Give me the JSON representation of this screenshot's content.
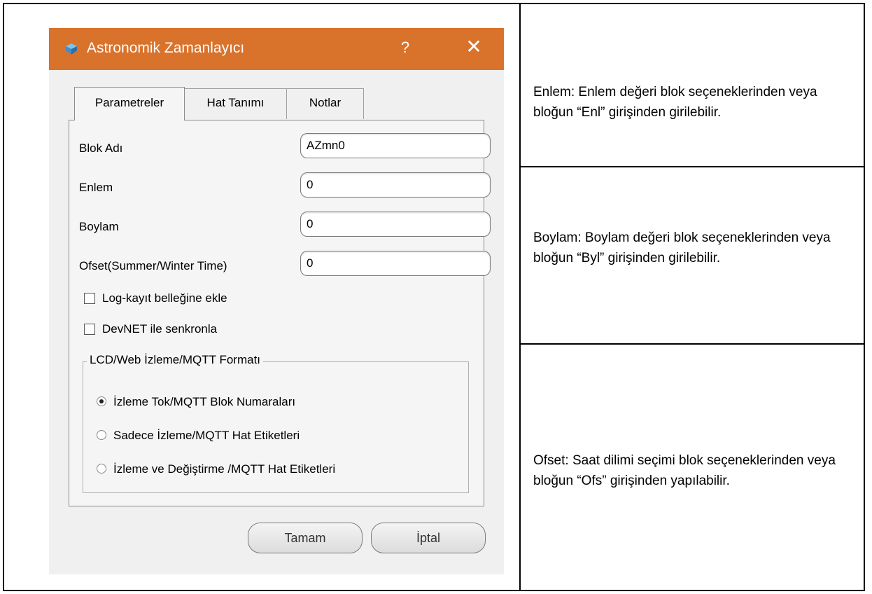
{
  "dialog": {
    "title": "Astronomik Zamanlayıcı",
    "help_label": "?",
    "close_label": "✕",
    "tabs": [
      {
        "label": "Parametreler",
        "active": true
      },
      {
        "label": "Hat Tanımı",
        "active": false
      },
      {
        "label": "Notlar",
        "active": false
      }
    ],
    "fields": [
      {
        "label": "Blok Adı",
        "value": "AZmn0"
      },
      {
        "label": "Enlem",
        "value": "0"
      },
      {
        "label": "Boylam",
        "value": "0"
      },
      {
        "label": "Ofset(Summer/Winter Time)",
        "value": "0"
      }
    ],
    "checkboxes": [
      {
        "label": "Log-kayıt belleğine ekle",
        "checked": false
      },
      {
        "label": "DevNET ile senkronla",
        "checked": false
      }
    ],
    "group": {
      "title": "LCD/Web İzleme/MQTT Formatı",
      "options": [
        {
          "label": "İzleme Tok/MQTT Blok Numaraları",
          "selected": true
        },
        {
          "label": "Sadece İzleme/MQTT Hat Etiketleri",
          "selected": false
        },
        {
          "label": "İzleme ve Değiştirme /MQTT Hat Etiketleri",
          "selected": false
        }
      ]
    },
    "buttons": {
      "ok": "Tamam",
      "cancel": "İptal"
    },
    "titlebar_color": "#d9722b"
  },
  "notes": [
    "Enlem:  Enlem değeri blok seçeneklerinden veya bloğun “Enl” girişinden girilebilir.",
    "Boylam:  Boylam değeri blok seçeneklerinden veya bloğun “Byl” girişinden girilebilir.",
    "Ofset:  Saat dilimi seçimi blok seçeneklerinden veya bloğun “Ofs” girişinden yapılabilir."
  ]
}
